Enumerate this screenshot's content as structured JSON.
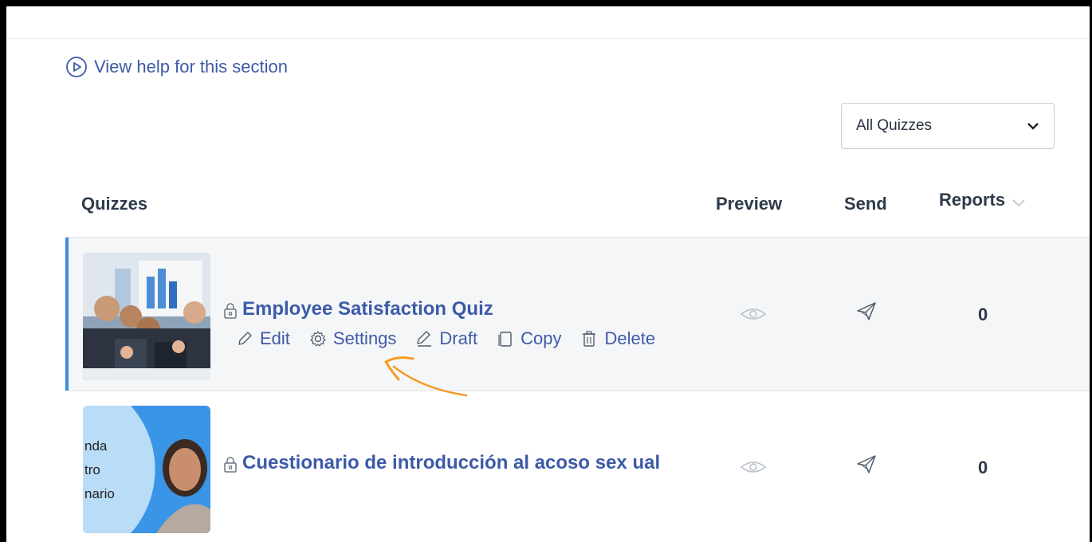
{
  "help": {
    "label": "View help for this section",
    "icon": "play-circle-icon"
  },
  "filter": {
    "selected": "All Quizzes"
  },
  "table": {
    "columns": {
      "quizzes": "Quizzes",
      "preview": "Preview",
      "send": "Send",
      "reports": "Reports"
    },
    "rows": [
      {
        "title": "Employee Satisfaction Quiz",
        "reports": "0",
        "actions": [
          "Edit",
          "Settings",
          "Draft",
          "Copy",
          "Delete"
        ],
        "selected": true
      },
      {
        "title": "Cuestionario de introducción al acoso sex ual",
        "reports": "0",
        "thumb_text": [
          "nda",
          "tro",
          "nario"
        ]
      }
    ]
  },
  "colors": {
    "accent": "#3d5aa8",
    "row_highlight": "#3b8ed8",
    "annotation": "#f59a23"
  }
}
